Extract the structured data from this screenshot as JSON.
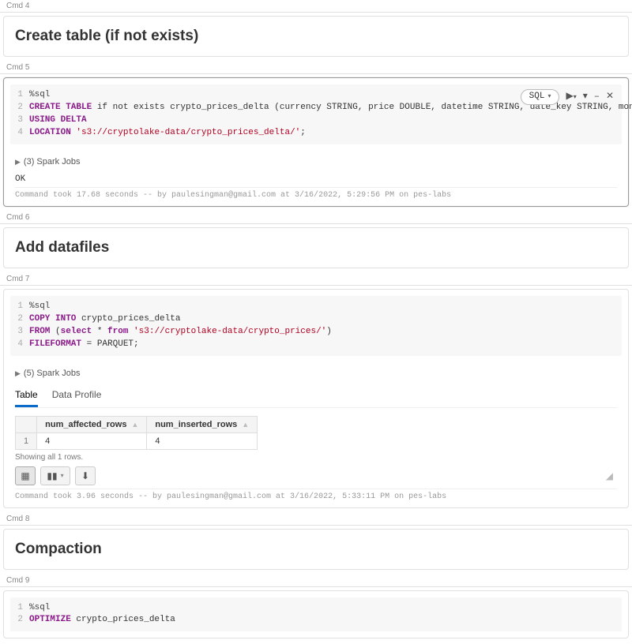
{
  "cmd4": {
    "header": "Cmd 4",
    "title": "Create table (if not exists)"
  },
  "cmd5": {
    "header": "Cmd 5",
    "lang_pill": "SQL",
    "code": {
      "l1": {
        "magic": "%sql"
      },
      "l2": {
        "kw1": "CREATE TABLE",
        "rest": " if not exists crypto_prices_delta (currency STRING, price DOUBLE, datetime STRING, date_key STRING, month_key STRING)"
      },
      "l3": {
        "kw1": "USING DELTA"
      },
      "l4": {
        "kw1": "LOCATION ",
        "str": "'s3://cryptolake-data/crypto_prices_delta/'",
        "tail": ";"
      }
    },
    "spark_label": "(3) Spark Jobs",
    "ok": "OK",
    "meta": "Command took 17.68 seconds -- by paulesingman@gmail.com at 3/16/2022, 5:29:56 PM on pes-labs"
  },
  "cmd6": {
    "header": "Cmd 6",
    "title": "Add datafiles"
  },
  "cmd7": {
    "header": "Cmd 7",
    "code": {
      "l1": {
        "magic": "%sql"
      },
      "l2": {
        "kw1": "COPY INTO",
        "rest": " crypto_prices_delta"
      },
      "l3": {
        "kw1": "FROM",
        "open": " (",
        "kw2": "select",
        "star": " * ",
        "kw3": "from ",
        "str": "'s3://cryptolake-data/crypto_prices/'",
        "close": ")"
      },
      "l4": {
        "kw1": "FILEFORMAT",
        "rest": " = PARQUET;"
      }
    },
    "spark_label": "(5) Spark Jobs",
    "tabs": {
      "table": "Table",
      "profile": "Data Profile"
    },
    "result": {
      "h1": "num_affected_rows",
      "h2": "num_inserted_rows",
      "rownum": "1",
      "c1": "4",
      "c2": "4"
    },
    "rows_note": "Showing all 1 rows.",
    "meta": "Command took 3.96 seconds -- by paulesingman@gmail.com at 3/16/2022, 5:33:11 PM on pes-labs"
  },
  "cmd8": {
    "header": "Cmd 8",
    "title": "Compaction"
  },
  "cmd9": {
    "header": "Cmd 9",
    "code": {
      "l1": {
        "magic": "%sql"
      },
      "l2": {
        "kw1": "OPTIMIZE",
        "rest": " crypto_prices_delta"
      }
    }
  }
}
